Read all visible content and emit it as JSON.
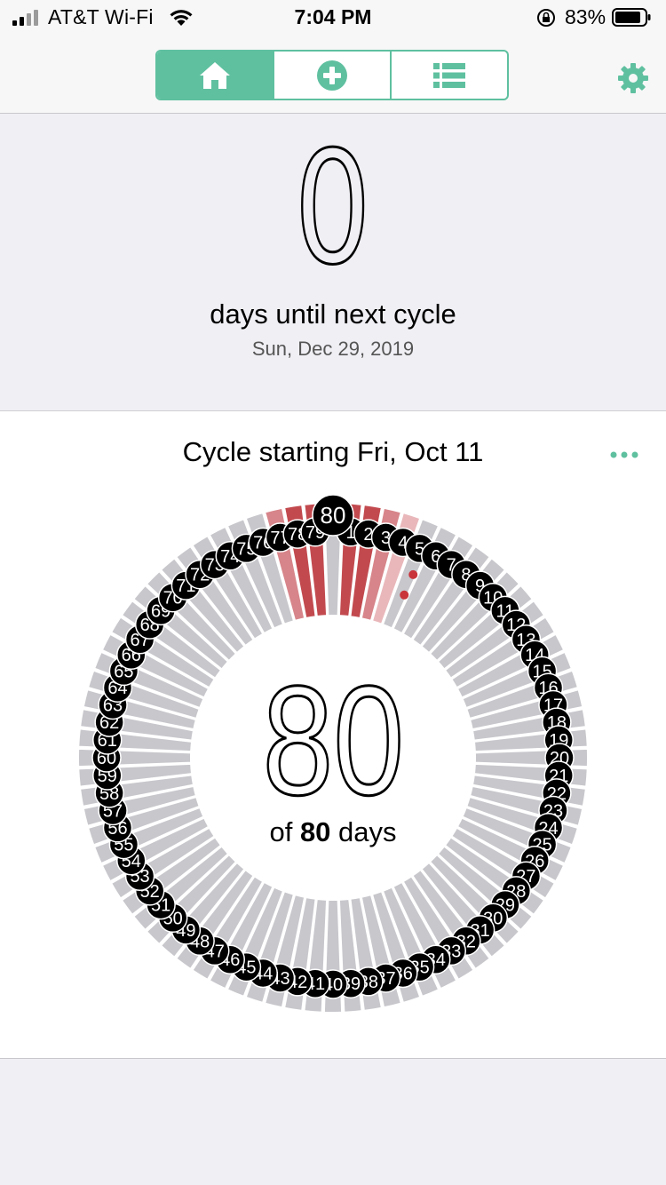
{
  "status_bar": {
    "carrier": "AT&T Wi-Fi",
    "time": "7:04 PM",
    "battery": "83%"
  },
  "nav": {
    "tabs": [
      {
        "icon": "home-icon",
        "active": true
      },
      {
        "icon": "add-circle-icon",
        "active": false
      },
      {
        "icon": "list-icon",
        "active": false
      }
    ],
    "settings_icon": "gear-icon",
    "accent_color": "#5fc0a0"
  },
  "summary": {
    "days_count": "0",
    "label": "days until next cycle",
    "date": "Sun, Dec 29, 2019"
  },
  "cycle": {
    "title": "Cycle starting Fri, Oct 11",
    "current_day": "80",
    "of_prefix": "of",
    "total_days": "80",
    "days_suffix": "days",
    "day_count": 80,
    "bleeding_days": [
      1,
      2,
      3,
      4,
      77,
      78,
      79
    ],
    "spotting_days": [
      5
    ],
    "colors": {
      "heavy": "#c24a4f",
      "medium": "#d7858a",
      "light": "#e9b7ba",
      "none": "#c7c7cc",
      "marker": "#000000"
    }
  }
}
